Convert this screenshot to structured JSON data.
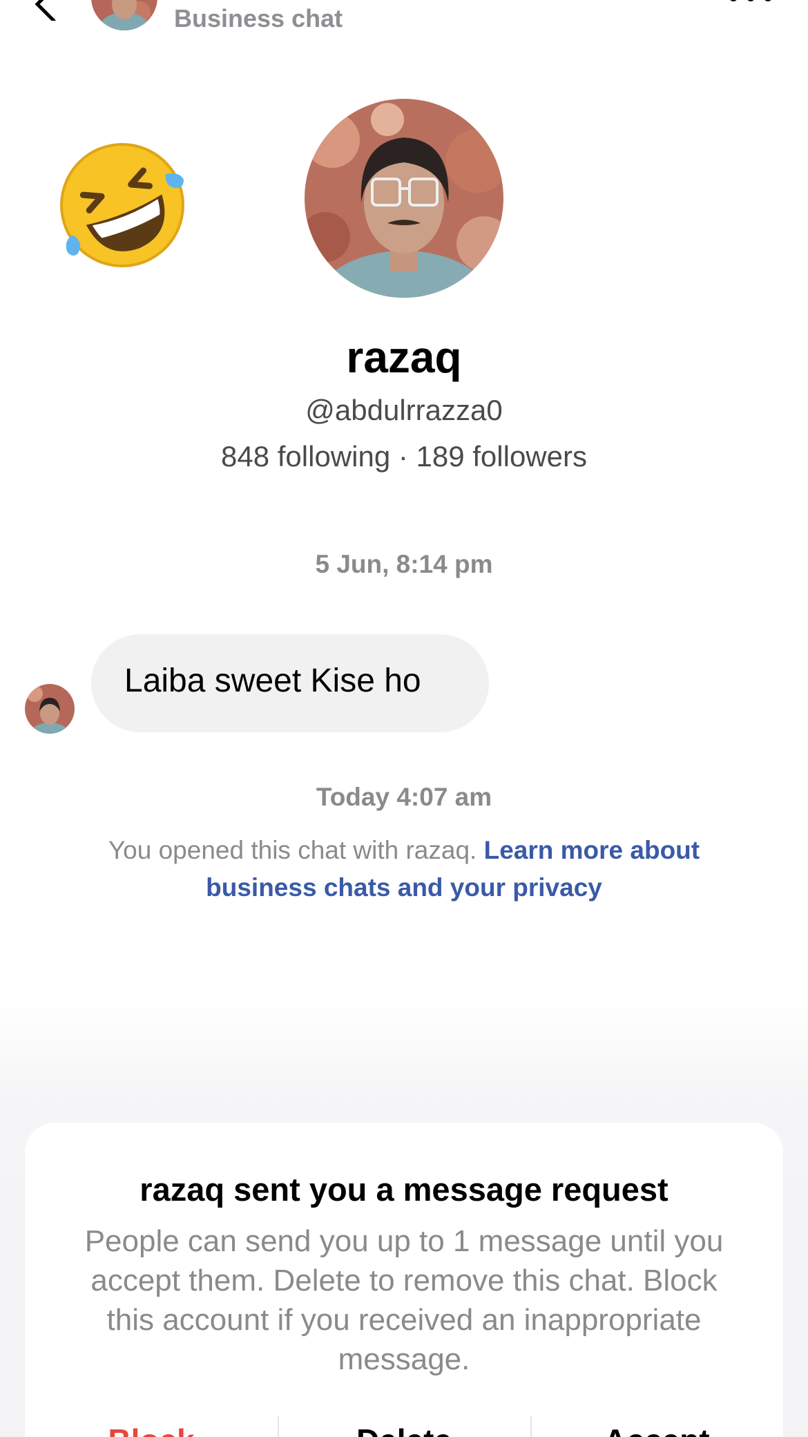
{
  "header": {
    "subtitle": "Business chat",
    "back_icon": "chevron-left-icon",
    "more_icon": "more-horizontal-icon"
  },
  "profile": {
    "reaction_emoji": "rolling-on-the-floor-laughing-emoji",
    "name": "razaq",
    "handle": "@abdulrrazza0",
    "stats": "848 following · 189 followers"
  },
  "conversation": {
    "timestamp_1": "5 Jun, 8:14 pm",
    "message_text": "Laiba sweet Kise ho",
    "timestamp_2": "Today 4:07 am",
    "privacy_text": "You opened this chat with razaq.",
    "privacy_link": "Learn more about business chats and your privacy"
  },
  "request_card": {
    "title": "razaq sent you a message request",
    "body": "People can send you up to 1 message until you accept them. Delete to remove this chat. Block this account if you received an inappropriate message.",
    "block_label": "Block",
    "delete_label": "Delete",
    "accept_label": "Accept"
  },
  "colors": {
    "link": "#3a5aa8",
    "block": "#e6483d",
    "bubble": "#f1f1f2",
    "muted_text": "#8a8a8a"
  }
}
